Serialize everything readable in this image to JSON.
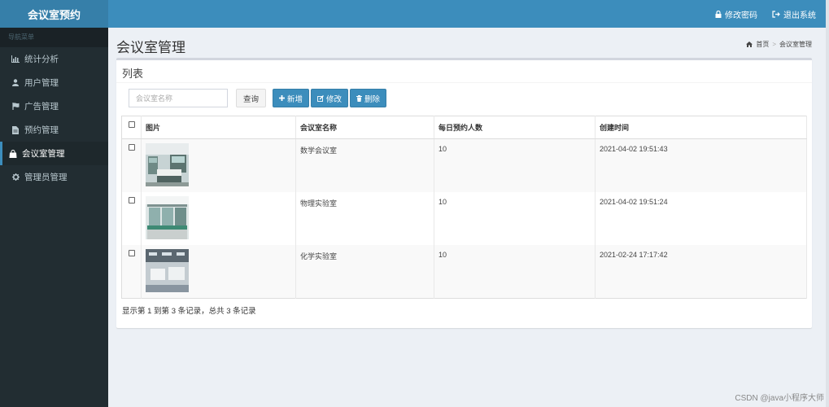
{
  "app": {
    "title": "会议室预约"
  },
  "header": {
    "change_password": "修改密码",
    "logout": "退出系统"
  },
  "sidebar": {
    "nav_header": "导航菜单",
    "items": [
      {
        "label": "统计分析",
        "icon": "bar-chart-icon"
      },
      {
        "label": "用户管理",
        "icon": "user-icon"
      },
      {
        "label": "广告管理",
        "icon": "flag-icon"
      },
      {
        "label": "预约管理",
        "icon": "file-icon"
      },
      {
        "label": "会议室管理",
        "icon": "shopping-bag-icon",
        "active": true
      },
      {
        "label": "管理员管理",
        "icon": "gear-icon"
      }
    ]
  },
  "page": {
    "title": "会议室管理",
    "breadcrumb": {
      "home": "首页",
      "current": "会议室管理"
    }
  },
  "box": {
    "title": "列表"
  },
  "toolbar": {
    "search_placeholder": "会议室名称",
    "query_label": "查询",
    "add_label": "新增",
    "edit_label": "修改",
    "delete_label": "删除"
  },
  "table": {
    "headers": {
      "picture": "图片",
      "name": "会议室名称",
      "capacity": "每日预约人数",
      "created": "创建时间"
    },
    "rows": [
      {
        "name": "数学会议室",
        "capacity": "10",
        "created": "2021-04-02 19:51:43"
      },
      {
        "name": "物理实验室",
        "capacity": "10",
        "created": "2021-04-02 19:51:24"
      },
      {
        "name": "化学实验室",
        "capacity": "10",
        "created": "2021-02-24 17:17:42"
      }
    ]
  },
  "pager": {
    "info": "显示第 1 到第 3 条记录，总共 3 条记录"
  },
  "watermark": "CSDN @java小程序大师",
  "colors": {
    "header": "#3c8dbc",
    "brand": "#367fa9",
    "sidebar": "#222d32",
    "button": "#3c8dbc"
  }
}
